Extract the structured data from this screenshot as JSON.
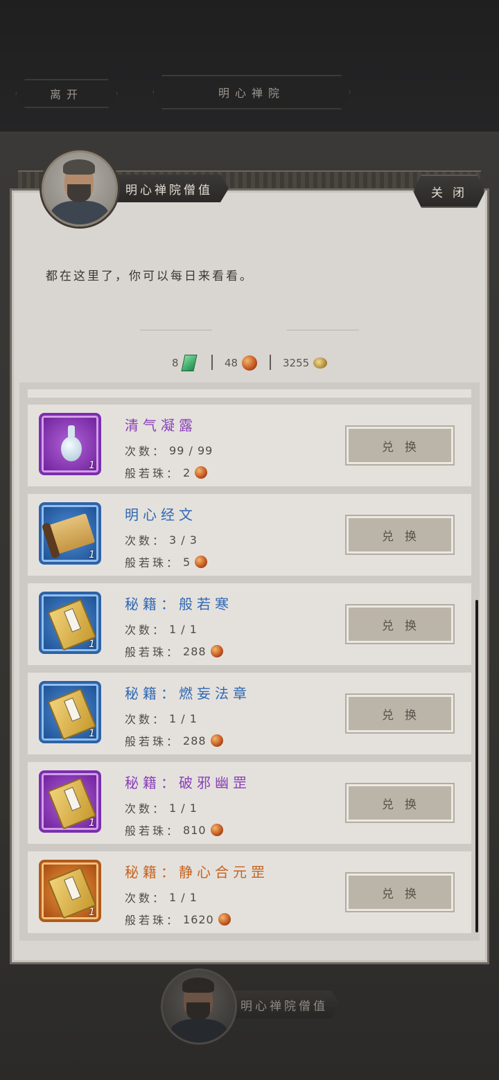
{
  "header": {
    "leave_label": "离开",
    "location_label": "明心禅院"
  },
  "npc": {
    "name": "明心禅院僧值",
    "close_label": "关闭",
    "dialog": "都在这里了，你可以每日来看看。"
  },
  "currencies": [
    {
      "amount": "8",
      "icon": "jade-token-icon"
    },
    {
      "amount": "48",
      "icon": "prajna-bead-icon"
    },
    {
      "amount": "3255",
      "icon": "gold-ingot-icon"
    }
  ],
  "items": [
    {
      "name": "清气凝露",
      "quality": "purple",
      "icon": "vase-icon",
      "qty": "1",
      "count_label": "次数：",
      "count": "99 / 99",
      "cost_label": "般若珠：",
      "cost": "2",
      "button": "兑换"
    },
    {
      "name": "明心经文",
      "quality": "blue",
      "icon": "scroll-icon",
      "qty": "1",
      "count_label": "次数：",
      "count": "3 / 3",
      "cost_label": "般若珠：",
      "cost": "5",
      "button": "兑换"
    },
    {
      "name": "秘籍：般若寒",
      "quality": "blue",
      "icon": "book-icon",
      "qty": "1",
      "count_label": "次数：",
      "count": "1 / 1",
      "cost_label": "般若珠：",
      "cost": "288",
      "button": "兑换"
    },
    {
      "name": "秘籍：燃妄法章",
      "quality": "blue",
      "icon": "book-icon",
      "qty": "1",
      "count_label": "次数：",
      "count": "1 / 1",
      "cost_label": "般若珠：",
      "cost": "288",
      "button": "兑换"
    },
    {
      "name": "秘籍：破邪幽罡",
      "quality": "purple",
      "icon": "book-icon",
      "qty": "1",
      "count_label": "次数：",
      "count": "1 / 1",
      "cost_label": "般若珠：",
      "cost": "810",
      "button": "兑换"
    },
    {
      "name": "秘籍：静心合元罡",
      "quality": "orange",
      "icon": "book-icon",
      "qty": "1",
      "count_label": "次数：",
      "count": "1 / 1",
      "cost_label": "般若珠：",
      "cost": "1620",
      "button": "兑换"
    }
  ],
  "footer": {
    "npc_name": "明心禅院僧值"
  }
}
